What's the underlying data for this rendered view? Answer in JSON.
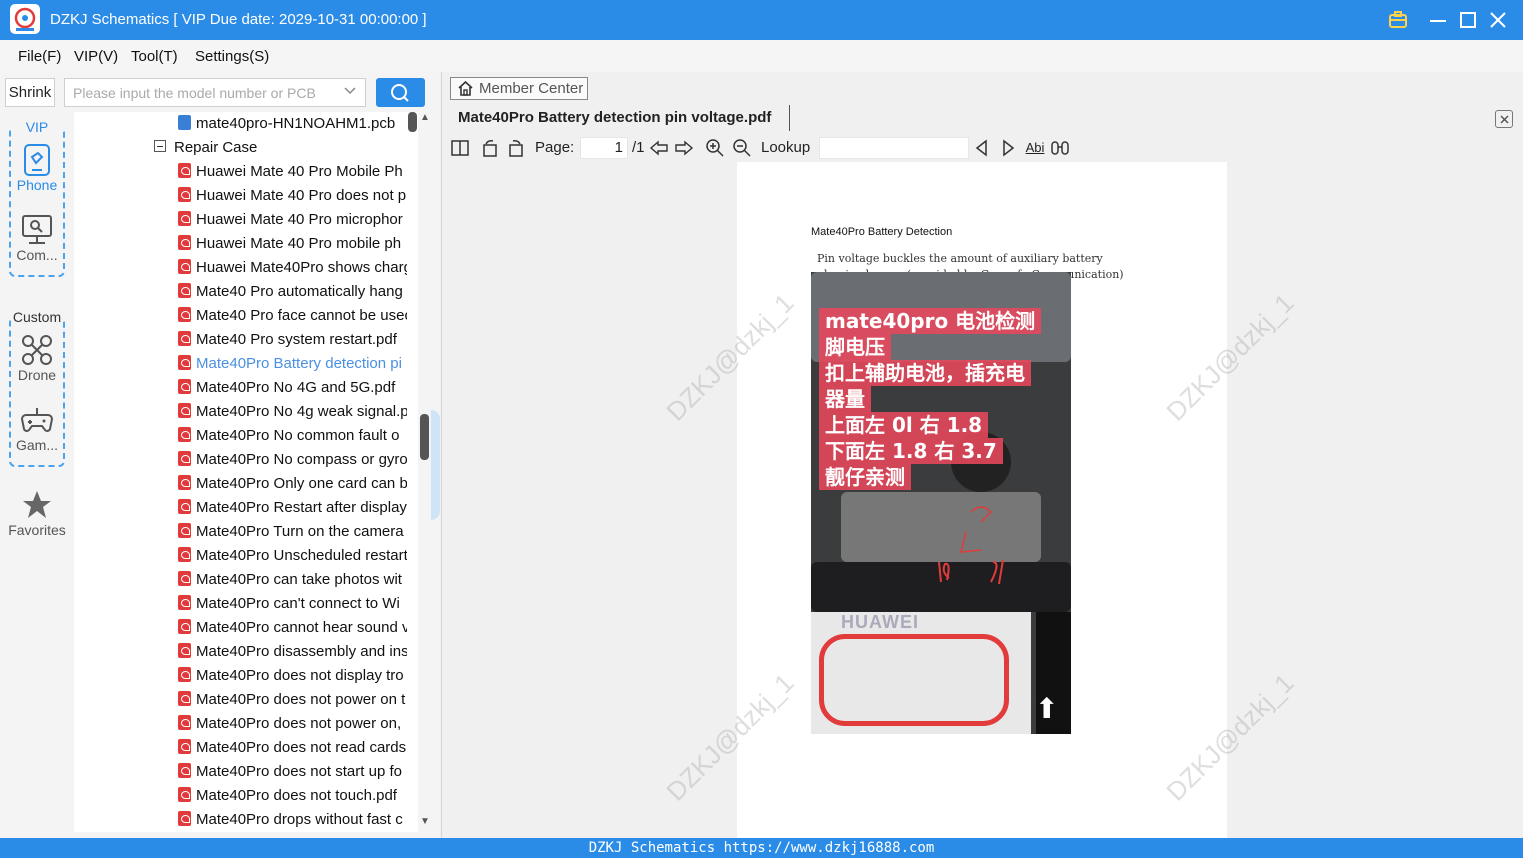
{
  "window": {
    "title": "DZKJ Schematics [ VIP Due date: 2029-10-31 00:00:00 ]"
  },
  "menu": {
    "file": "File(F)",
    "vip": "VIP(V)",
    "tool": "Tool(T)",
    "settings": "Settings(S)"
  },
  "search": {
    "shrink_label": "Shrink",
    "placeholder": "Please input the model number or PCB"
  },
  "categories": {
    "vip_group": "VIP",
    "phone": "Phone",
    "computer": "Com...",
    "custom_group": "Custom",
    "drone": "Drone",
    "game": "Gam...",
    "favorites": "Favorites"
  },
  "tree": {
    "pcb_file": "mate40pro-HN1NOAHM1.pcb",
    "folder": "Repair Case",
    "items": [
      "Huawei Mate 40 Pro Mobile Ph",
      "Huawei Mate 40 Pro does not p",
      "Huawei Mate 40 Pro microphor",
      "Huawei Mate 40 Pro mobile ph",
      "Huawei Mate40Pro shows charg",
      "Mate40 Pro automatically hang",
      "Mate40 Pro face cannot be usec",
      "Mate40 Pro system restart.pdf",
      "Mate40Pro Battery detection pi",
      "Mate40Pro No 4G and 5G.pdf",
      "Mate40Pro No 4g weak signal.p",
      "Mate40Pro No common fault o",
      "Mate40Pro No compass or gyro",
      "Mate40Pro Only one card can b",
      "Mate40Pro Restart after display",
      "Mate40Pro Turn on the camera",
      "Mate40Pro Unscheduled restart",
      "Mate40Pro can take photos wit",
      "Mate40Pro can't connect to Wi",
      "Mate40Pro cannot hear sound v",
      "Mate40Pro disassembly and ins",
      "Mate40Pro does not display tro",
      "Mate40Pro does not power on t",
      "Mate40Pro does not power on,",
      "Mate40Pro does not read cards",
      "Mate40Pro does not start up fo",
      "Mate40Pro does not touch.pdf",
      "Mate40Pro drops without fast c"
    ],
    "selected_index": 8
  },
  "viewer": {
    "member_center": "Member Center",
    "doc_tab": "Mate40Pro Battery detection pin voltage.pdf",
    "page_label": "Page:",
    "page_current": "1",
    "page_total": "/1",
    "lookup_label": "Lookup",
    "abi_label": "Abi"
  },
  "pdf": {
    "heading": "Mate40Pro Battery Detection",
    "caption_1": "Pin voltage buckles the amount of auxiliary battery",
    "caption_2": "plug-in charger (provided by Guangfa Communication)",
    "photo_lines": [
      "mate40pro 电池检测",
      "脚电压",
      "扣上辅助电池，插充电",
      "器量",
      "上面左 0l 右 1.8",
      "下面左 1.8 右 3.7",
      "靓仔亲测"
    ],
    "brand": "HUAWEI",
    "watermark": "DZKJ@dzkj_1"
  },
  "status": {
    "text": "DZKJ Schematics https://www.dzkj16888.com"
  },
  "colors": {
    "accent": "#2b8ce8",
    "pdf_icon": "#e03a3a",
    "selected_text": "#4a90e2"
  }
}
